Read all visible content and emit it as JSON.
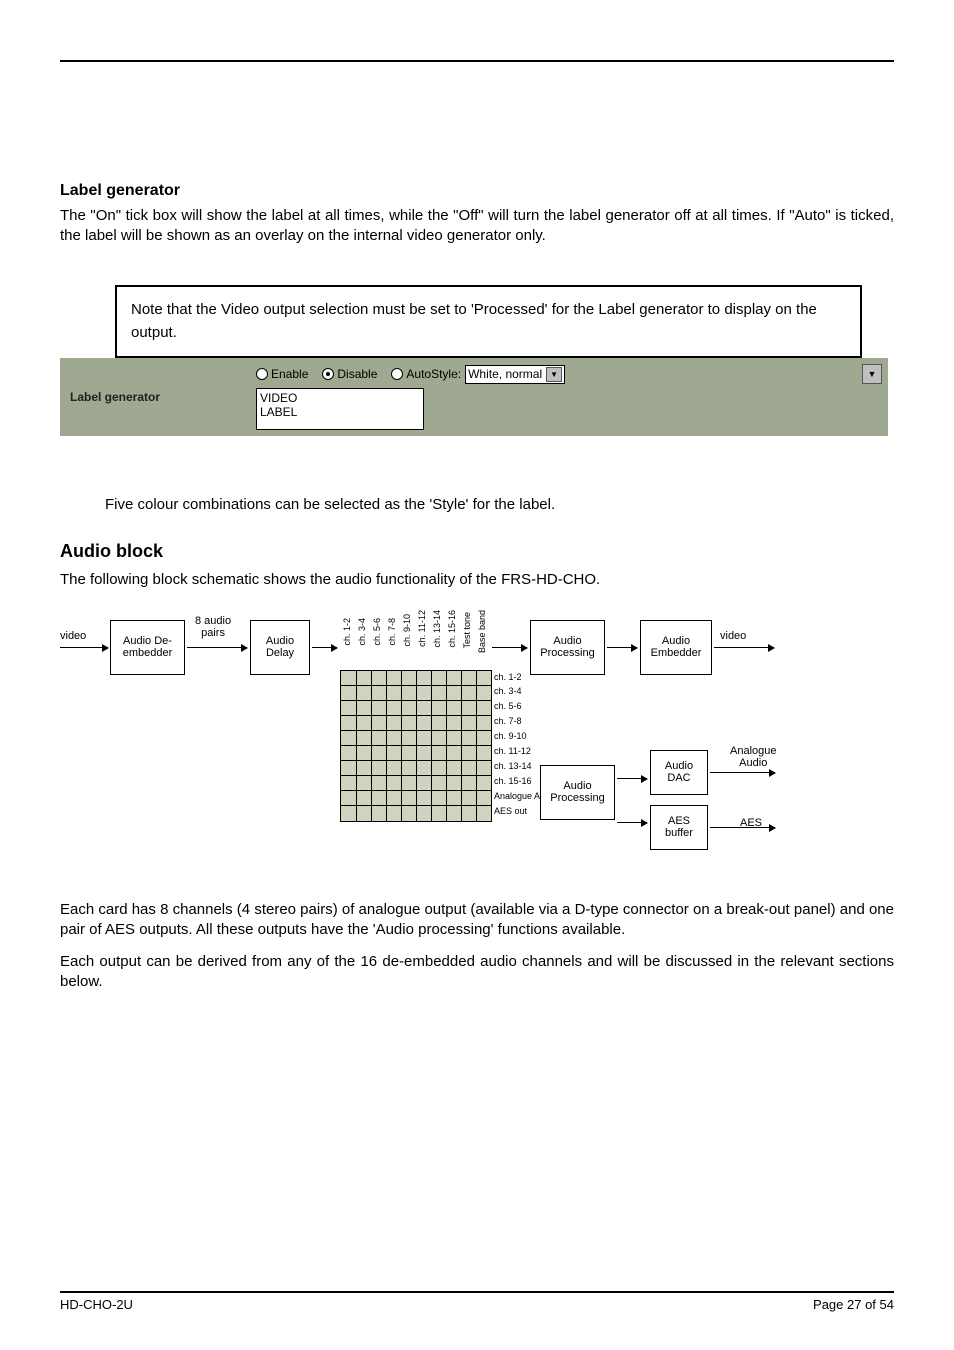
{
  "header": {
    "section_title": "Label generator"
  },
  "paras": {
    "p1": "The \"On\" tick box will show the label at all times, while the \"Off\" will turn the label generator off at all times. If \"Auto\" is ticked, the label will be shown as an overlay on the internal video generator only.",
    "note": "Note that the Video output selection must be set to 'Processed' for the Label generator to display on the output.",
    "p2": "Five colour combinations can be selected as the 'Style' for the label.",
    "audio_title": "Audio block",
    "p3": "The following block schematic shows the audio functionality of the FRS-HD-CHO.",
    "p4": "Each card has 8 channels (4 stereo pairs) of analogue output (available via a D-type connector on a break-out panel) and one pair of AES outputs. All these outputs have the 'Audio processing' functions available.",
    "p5": "Each output can be derived from any of the 16 de-embedded audio channels and will be discussed in the relevant sections below."
  },
  "lg": {
    "left_label": "Label generator",
    "radios": {
      "enable": "Enable",
      "disable": "Disable",
      "auto": "Auto"
    },
    "style_label": "Style:",
    "style_value": "White, normal",
    "text_value": "VIDEO\nLABEL"
  },
  "diagram": {
    "in_label": "video",
    "out_video": "video",
    "out_analogue": "Analogue\nAudio",
    "out_aes": "AES",
    "deembed": "Audio De-\nembedder",
    "pairs_label": "8 audio\npairs",
    "delay": "Audio\nDelay",
    "proc1": "Audio\nProcessing",
    "embed": "Audio\nEmbedder",
    "proc2": "Audio\nProcessing",
    "dac": "Audio\nDAC",
    "aesbuf": "AES\nbuffer",
    "v_cols": [
      "ch. 1-2",
      "ch. 3-4",
      "ch. 5-6",
      "ch. 7-8",
      "ch. 9-10",
      "ch. 11-12",
      "ch. 13-14",
      "ch. 15-16",
      "Test tone",
      "Base band"
    ],
    "h_rows": [
      "ch. 1-2",
      "ch. 3-4",
      "ch. 5-6",
      "ch. 7-8",
      "ch. 9-10",
      "ch. 11-12",
      "ch. 13-14",
      "ch. 15-16",
      "Analogue Audio out",
      "AES out"
    ]
  },
  "footer": {
    "left": "HD-CHO-2U",
    "right": "Page 27 of 54"
  }
}
